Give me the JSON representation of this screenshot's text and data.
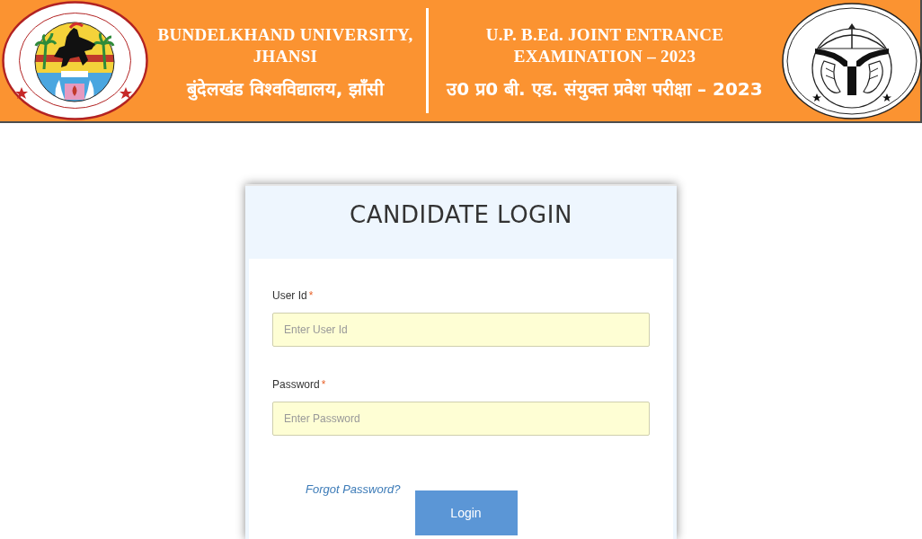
{
  "header": {
    "university": {
      "name_lines": [
        "BUNDELKHAND UNIVERSITY,",
        "JHANSI"
      ],
      "name_hindi": "बुंदेलखंड विश्वविद्यालय, झाँसी"
    },
    "exam": {
      "title_lines": [
        "U.P. B.Ed. JOINT ENTRANCE",
        "EXAMINATION – 2023"
      ],
      "title_hindi": "उ0 प्र0 बी. एड. संयुक्त प्रवेश परीक्षा – 2023"
    }
  },
  "login_card": {
    "title": "CANDIDATE LOGIN",
    "fields": [
      {
        "label": "User Id",
        "required_mark": "*",
        "placeholder": "Enter User Id"
      },
      {
        "label": "Password",
        "required_mark": "*",
        "placeholder": "Enter Password"
      }
    ],
    "forgot_link": "Forgot Password?",
    "submit_button": "Login"
  }
}
